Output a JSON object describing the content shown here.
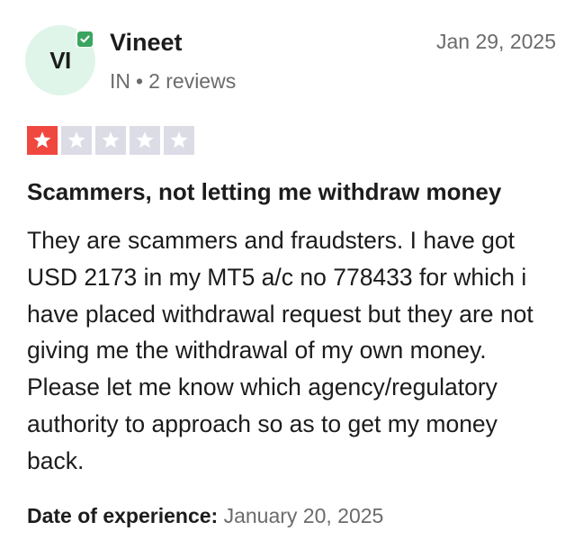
{
  "reviewer": {
    "initials": "VI",
    "name": "Vineet",
    "country": "IN",
    "separator": "•",
    "review_count": "2 reviews"
  },
  "review": {
    "date": "Jan 29, 2025",
    "rating": 1,
    "max_rating": 5,
    "title": "Scammers, not letting me withdraw money",
    "body": "They are scammers and fraudsters. I have got USD 2173 in my MT5 a/c no 778433 for which i have placed withdrawal request but they are not giving me the withdrawal of my own money. Please let me know which agency/regulatory authority to approach so as to get my money back.",
    "experience_label": "Date of experience:",
    "experience_date": "January 20, 2025"
  },
  "colors": {
    "star_filled": "#f0473f",
    "star_empty": "#dcdce6",
    "avatar_bg": "#dff5e9",
    "verified": "#3aa55f"
  },
  "icons": {
    "verified": "verified-check-icon",
    "star": "star-icon"
  }
}
